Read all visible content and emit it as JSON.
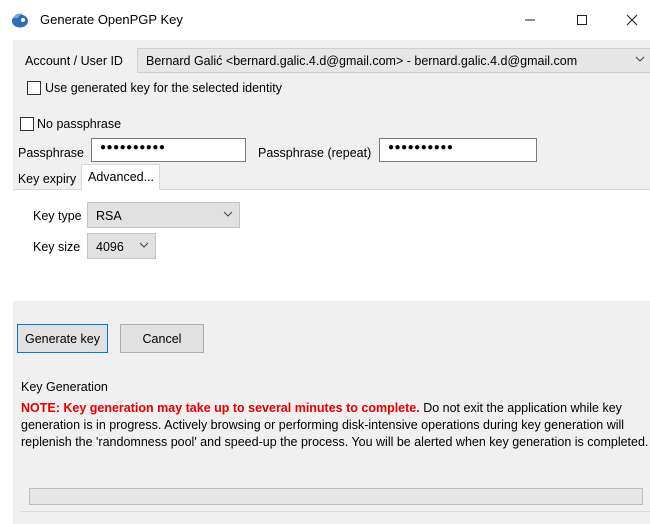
{
  "window": {
    "title": "Generate OpenPGP Key",
    "min_glyph": "—",
    "max_glyph": "☐",
    "close_glyph": "✕"
  },
  "account": {
    "label": "Account / User ID",
    "selected": "Bernard Galić <bernard.galic.4.d@gmail.com> - bernard.galic.4.d@gmail.com",
    "use_generated_label": "Use generated key for the selected identity",
    "use_generated_checked": false
  },
  "passphrase": {
    "no_passphrase_label": "No passphrase",
    "no_passphrase_checked": false,
    "label": "Passphrase",
    "value": "●●●●●●●●●●",
    "repeat_label": "Passphrase (repeat)",
    "repeat_value": "●●●●●●●●●●"
  },
  "tabs": [
    {
      "label": "Key expiry",
      "active": false
    },
    {
      "label": "Advanced...",
      "active": true
    }
  ],
  "advanced": {
    "key_type_label": "Key type",
    "key_type_value": "RSA",
    "key_size_label": "Key size",
    "key_size_value": "4096"
  },
  "buttons": {
    "generate": "Generate key",
    "cancel": "Cancel"
  },
  "key_generation": {
    "title": "Key Generation",
    "warning": "NOTE: Key generation may take up to several minutes to complete.",
    "body": " Do not exit the application while key generation is in progress. Actively browsing or performing disk-intensive operations during key generation will replenish the 'randomness pool' and speed-up the process. You will be alerted when key generation is completed.",
    "progress": 0
  },
  "colors": {
    "accent": "#0078d7",
    "warning": "#e60000",
    "app_icon": "#2e6db4"
  }
}
